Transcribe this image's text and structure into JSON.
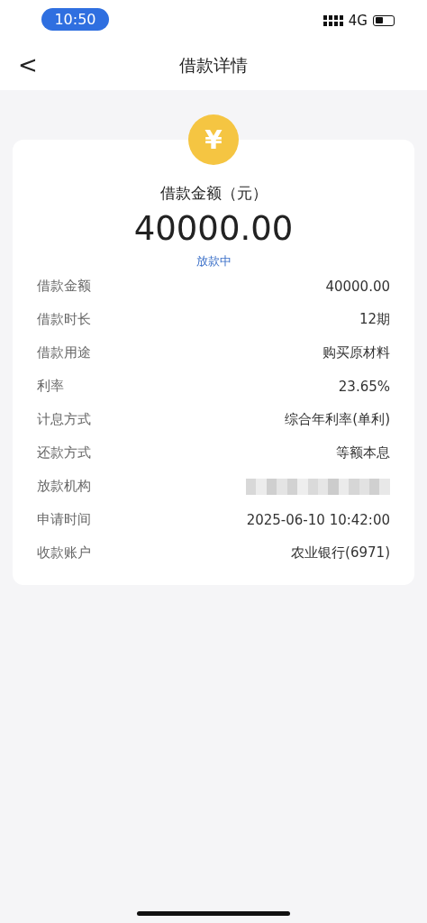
{
  "status_bar": {
    "time": "10:50",
    "network": "4G"
  },
  "nav": {
    "back": "<",
    "title": "借款详情"
  },
  "summary": {
    "icon": "¥",
    "label": "借款金额（元）",
    "amount": "40000.00",
    "status": "放款中"
  },
  "details": [
    {
      "label": "借款金额",
      "value": "40000.00",
      "redacted": false
    },
    {
      "label": "借款时长",
      "value": "12期",
      "redacted": false
    },
    {
      "label": "借款用途",
      "value": "购买原材料",
      "redacted": false
    },
    {
      "label": "利率",
      "value": "23.65%",
      "redacted": false
    },
    {
      "label": "计息方式",
      "value": "综合年利率(单利)",
      "redacted": false
    },
    {
      "label": "还款方式",
      "value": "等额本息",
      "redacted": false
    },
    {
      "label": "放款机构",
      "redacted": true
    },
    {
      "label": "申请时间",
      "value": "2025-06-10 10:42:00",
      "redacted": false
    },
    {
      "label": "收款账户",
      "value": "农业银行(6971)",
      "redacted": false
    }
  ]
}
